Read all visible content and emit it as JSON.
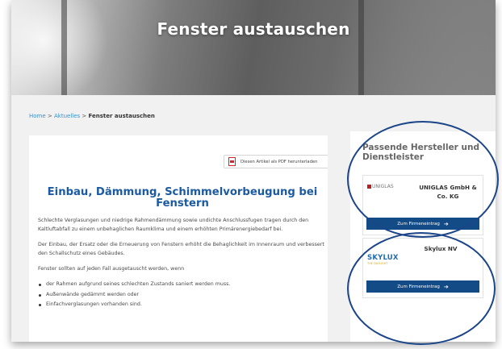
{
  "hero": {
    "title": "Fenster austauschen"
  },
  "breadcrumb": {
    "home": "Home",
    "sep1": " > ",
    "section": "Aktuelles",
    "sep2": " > ",
    "current": "Fenster austauschen"
  },
  "article": {
    "pdf_link": "Diesen Artikel als PDF herunterladen",
    "title": "Einbau, Dämmung, Schimmelvorbeugung bei Fenstern",
    "paragraphs": [
      "Schlechte Verglasungen und niedrige Rahmendämmung sowie undichte Anschlussfugen tragen durch den Kaltluftabfall zu einem unbehaglichen Raumklima und einem erhöhten Primärenergiebedarf bei.",
      "Der Einbau, der Ersatz oder die Erneuerung von Fenstern erhöht die Behaglichkeit im Innenraum und verbessert den Schallschutz eines Gebäudes.",
      "Fenster sollten auf jeden Fall ausgetauscht werden, wenn"
    ],
    "bullets": [
      "der Rahmen aufgrund seines schlechten Zustands saniert werden muss.",
      "Außenwände gedämmt werden oder",
      "Einfachverglasungen vorhanden sind."
    ]
  },
  "sidebar": {
    "heading": "Passende Hersteller und Dienstleister",
    "companies": [
      {
        "logo": "UNIGLAS",
        "name": "UNIGLAS GmbH & Co. KG",
        "button": "Zum Firmeneintrag"
      },
      {
        "logo": "SKYLUX",
        "logo_sub": "THE DAYLIGHT",
        "name": "Skylux NV",
        "button": "Zum Firmeneintrag"
      }
    ]
  },
  "colors": {
    "title_blue": "#1b5aa3",
    "button_navy": "#134b86",
    "link_blue": "#3d8fc9",
    "pdf_red": "#d7262b",
    "circle_navy": "#1b4589"
  }
}
